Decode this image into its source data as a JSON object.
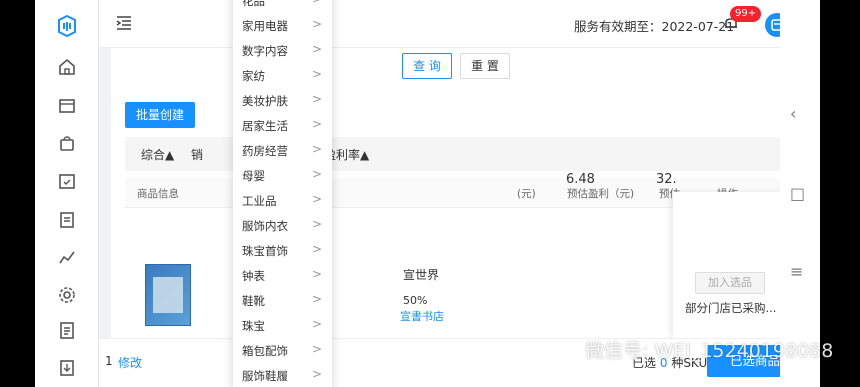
{
  "header": {
    "service_label": "服务有效期至：2022-07-21",
    "badge": "99+"
  },
  "toolbar": {
    "query": "查 询",
    "reset": "重 置",
    "batch_create": "批量创建"
  },
  "sort": {
    "items": [
      {
        "label": "综合▲"
      },
      {
        "label": "销"
      },
      {
        "label": "预估盈利率▲"
      }
    ]
  },
  "table": {
    "headers": [
      "商品信息",
      "(元)",
      "预估盈利（元)",
      "预估",
      "操作"
    ],
    "row": {
      "title_frag": "宣世界",
      "percent_frag": "50%",
      "shop_frag": "宣書书店",
      "profit": "6.48",
      "profit2": "32.",
      "add_button": "加入选品",
      "note": "部分门店已采购..."
    }
  },
  "bottom": {
    "page_num": "1",
    "edit": "修改",
    "selected_prefix": "已选",
    "selected_count": "0",
    "selected_suffix": "种SKU",
    "selected_button": "已选商品"
  },
  "category_menu": {
    "items": [
      {
        "label": "花品"
      },
      {
        "label": "家用电器"
      },
      {
        "label": "数字内容"
      },
      {
        "label": "家纺"
      },
      {
        "label": "美妆护肤"
      },
      {
        "label": "居家生活"
      },
      {
        "label": "药房经营"
      },
      {
        "label": "母婴"
      },
      {
        "label": "工业品"
      },
      {
        "label": "服饰内衣"
      },
      {
        "label": "珠宝首饰"
      },
      {
        "label": "钟表"
      },
      {
        "label": "鞋靴"
      },
      {
        "label": "珠宝"
      },
      {
        "label": "箱包配饰"
      },
      {
        "label": "服饰鞋履"
      }
    ],
    "arrow": ">"
  },
  "watermark": "微信号: WEI_15240198088",
  "colors": {
    "primary": "#1890ff",
    "badge": "#f5222d",
    "sidebar_icon": "#555555"
  },
  "icons": [
    "logo-icon",
    "home-icon",
    "shop-icon",
    "bag-icon",
    "calendar-check-icon",
    "clipboard-icon",
    "chart-icon",
    "settings-icon",
    "document-icon",
    "download-icon",
    "collapse-menu-icon",
    "bell-icon",
    "avatar-icon",
    "chevron-left-icon",
    "square-icon",
    "menu-icon"
  ]
}
